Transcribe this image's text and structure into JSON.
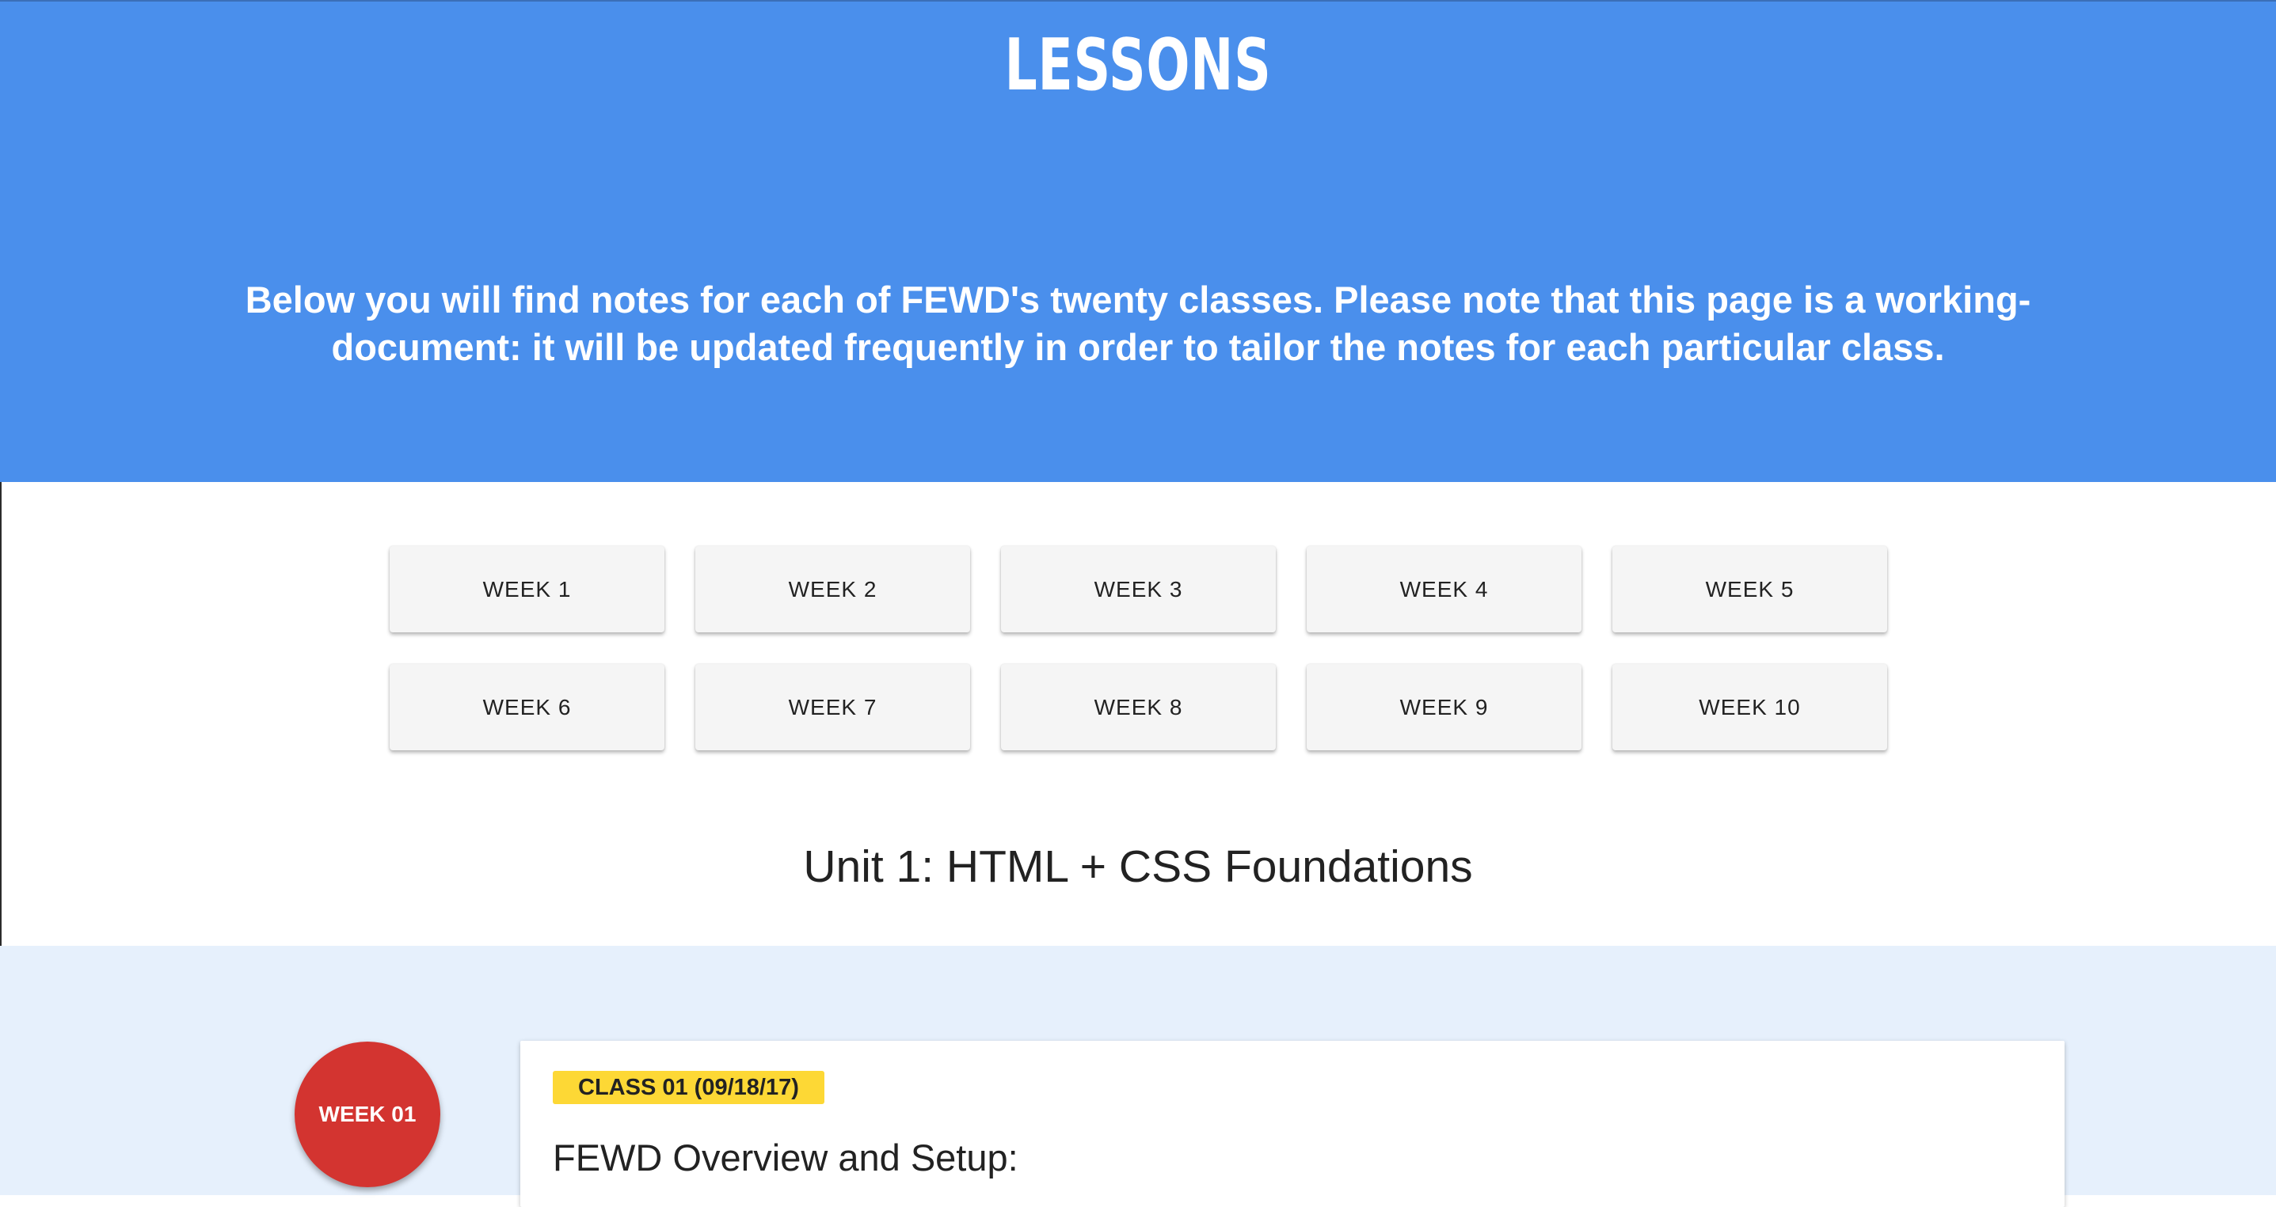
{
  "header": {
    "title": "LESSONS",
    "intro": "Below you will find notes for each of FEWD's twenty classes. Please note that this page is a working-document: it will be updated frequently in order to tailor the notes for each particular class."
  },
  "weeks": [
    "WEEK 1",
    "WEEK 2",
    "WEEK 3",
    "WEEK 4",
    "WEEK 5",
    "WEEK 6",
    "WEEK 7",
    "WEEK 8",
    "WEEK 9",
    "WEEK 10"
  ],
  "unit": {
    "heading": "Unit 1: HTML + CSS Foundations"
  },
  "timeline": {
    "week_label": "WEEK 01",
    "class_badge": "CLASS 01 (09/18/17)",
    "class_title": "FEWD Overview and Setup:"
  },
  "colors": {
    "hero_bg": "#4a8fec",
    "timeline_bg": "#e6f0fc",
    "week_circle": "#d33430",
    "badge": "#fdd835"
  }
}
